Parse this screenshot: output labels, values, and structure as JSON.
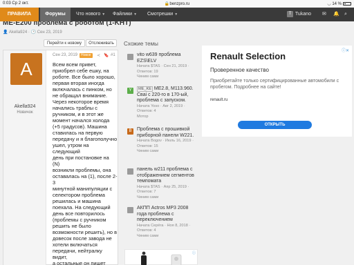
{
  "status": {
    "time": "0:03",
    "date": "Ср 2 окт.",
    "url": "benzpro.ru",
    "battery": "14 %"
  },
  "nav": {
    "rules": "ПРАВИЛА",
    "forums": "Форумы",
    "whats_new": "Что нового",
    "files": "Файлики",
    "watch": "Смотрешки",
    "user": "Tukano",
    "user_initial": "T"
  },
  "thread": {
    "title_partial": "ME-E200 проблема с роботом (1-KHT)",
    "author": "Akella924",
    "date": "Сен 23, 2019",
    "btn_goto_new": "Перейти к новому",
    "btn_watch": "Отслеживать"
  },
  "post": {
    "avatar_letter": "A",
    "username": "Akella924",
    "rank": "Новичок",
    "date": "Сен 23, 2019",
    "badge": "Новое",
    "number": "#1",
    "body_lines": [
      "Всем всем привет,",
      "приобрел себе ешку, на",
      "роботе. Все было хорошо,",
      "первая вторая иногда",
      "включалась с пинком, но",
      "не обращал внимание.",
      "Через некоторое время",
      "начались траблы с",
      "ручником, и в этот же",
      "момент начался холода",
      "(+5 градусов). Машина",
      "ставилась на первую",
      "передачу и я благополучно",
      "ушел, утром на следующий",
      "день при постановке на (N)",
      "возникли проблемы, она",
      "оставалась на (1), после 2-3",
      "минутной манипуляции с",
      "селектором проблема",
      "решилась и машина",
      "поехала. На следующий",
      "день все повторилось",
      "(проблемы с ручником",
      "решить не было",
      "возможности решить), но в",
      "довесок после заводa не",
      "хотели включаться",
      "передачи, нейтралку видит,",
      "а остальные он пишет",
      "(SELECT GEAR AGAIN),"
    ]
  },
  "similar": {
    "title": "Схожие темы",
    "items": [
      {
        "icon": "",
        "title": "vito w639 проблема EZS\\ELV",
        "tag": "",
        "meta1": "Начата $TAS · Сен 21, 2019 ·",
        "meta2": "Ответов: 19",
        "meta3": "Чиним сами",
        "icon_color": "#9a9a9a"
      },
      {
        "icon": "Y",
        "title": " ME2.8, M113.960. Сваi с 220-го в 170-ый, проблема с запуском.",
        "tag": "ME_KE",
        "meta1": "Начата Yoso · Авг 2, 2019 ·",
        "meta2": "Ответов: 4",
        "meta3": "Мотор",
        "icon_color": "#5cae4a"
      },
      {
        "icon": "B",
        "title": "Проблема с прошивкой приборной панели W221.",
        "tag": "",
        "meta1": "Начата Bogov · Июль 16, 2019 · Ответов: 15",
        "meta2": "Чиним сами",
        "meta3": "",
        "icon_color": "#c86a1a"
      },
      {
        "icon": "",
        "title": "панель w211 проблема с отображением сегментов темпомата",
        "tag": "",
        "meta1": "Начата $TAS · Апр 25, 2019 ·",
        "meta2": "Ответов: 7",
        "meta3": "Чиним сами",
        "icon_color": "#9a9a9a"
      },
      {
        "icon": "",
        "title": "АКПП Actros MP3 2008 года проблема с переключением",
        "tag": "",
        "meta1": "Начата Серёга · Ноя 8, 2018 · Ответов: 4",
        "meta2": "Чиним сами",
        "meta3": "",
        "icon_color": "#9a9a9a"
      }
    ]
  },
  "ad": {
    "title": "Renault Selection",
    "subtitle": "Проверенное качество",
    "description": "Приобретайте только сертифицированные автомобили с пробегом. Подробнее на сайте!",
    "domain": "renault.ru",
    "button": "ОТКРЫТЬ",
    "info": "ⓘ✕"
  },
  "ad2": {
    "info": "ⓘ"
  }
}
